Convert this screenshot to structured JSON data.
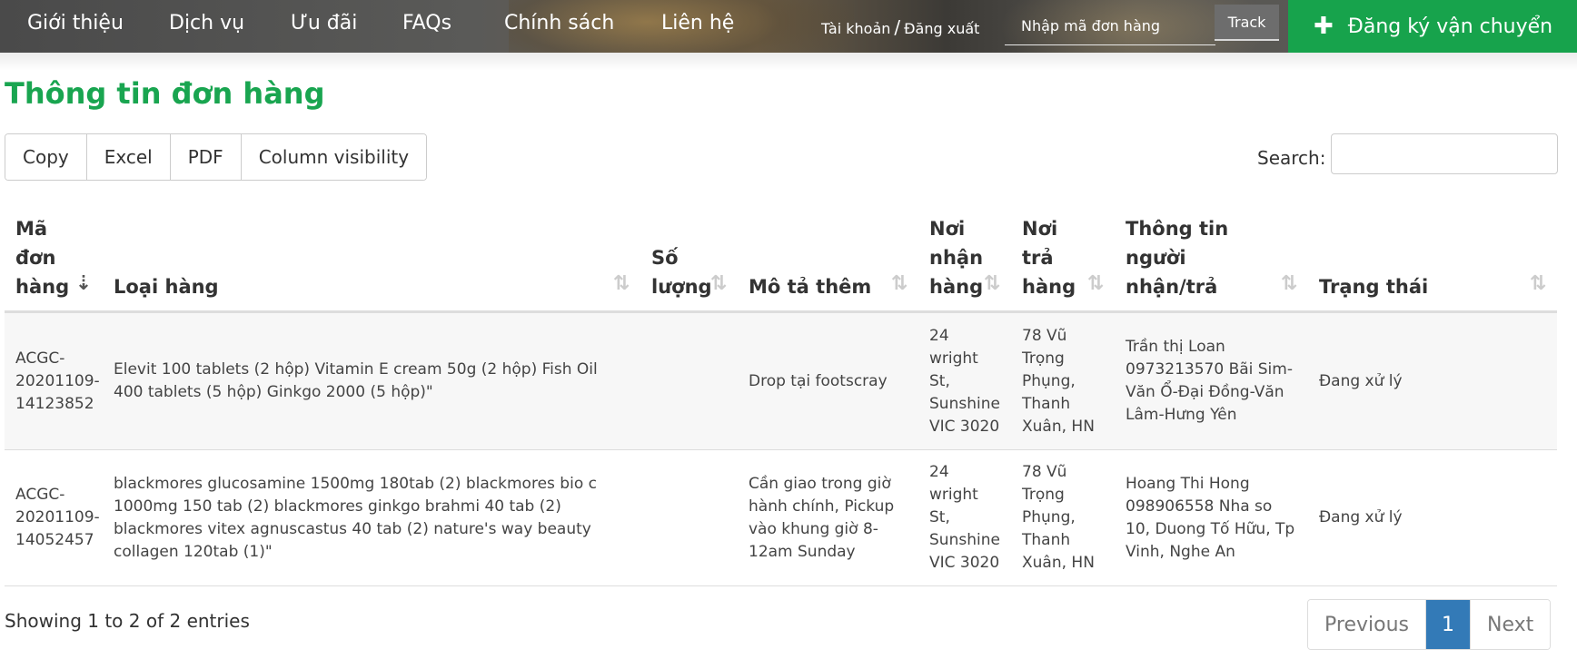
{
  "nav": {
    "items": [
      "Giới thiệu",
      "Dịch vụ",
      "Ưu đãi",
      "FAQs",
      "Chính sách",
      "Liên hệ"
    ],
    "account": "Tài khoản",
    "account_separator": "/",
    "logout": "Đăng xuất",
    "track_placeholder": "Nhập mã đơn hàng",
    "track_button": "Track",
    "register_button": "Đăng ký vận chuyển",
    "register_icon": "plus-icon"
  },
  "page": {
    "title": "Thông tin đơn hàng"
  },
  "toolbar": {
    "buttons": [
      "Copy",
      "Excel",
      "PDF",
      "Column visibility"
    ],
    "search_label": "Search:",
    "search_value": ""
  },
  "table": {
    "columns": [
      {
        "label": "Mã đơn hàng",
        "sort": "sorted-desc-icon"
      },
      {
        "label": "Loại hàng",
        "sort": "sort-icon"
      },
      {
        "label": "Số lượng",
        "sort": "sort-icon"
      },
      {
        "label": "Mô tả thêm",
        "sort": "sort-icon"
      },
      {
        "label": "Nơi nhận hàng",
        "sort": "sort-icon"
      },
      {
        "label": "Nơi trả hàng",
        "sort": "sort-icon"
      },
      {
        "label": "Thông tin người nhận/trả",
        "sort": "sort-icon"
      },
      {
        "label": "Trạng thái",
        "sort": "sort-icon"
      }
    ],
    "rows": [
      {
        "order_id": "ACGC-20201109-14123852",
        "goods": "Elevit 100 tablets (2 hộp) Vitamin E cream 50g (2 hộp) Fish Oil 400 tablets (5 hộp) Ginkgo 2000 (5 hộp)\"",
        "quantity": "",
        "note": "Drop tại footscray",
        "pickup": "24 wright St, Sunshine VIC 3020",
        "dropoff": "78 Vũ Trọng Phụng, Thanh Xuân, HN",
        "recipient": "Trần thị Loan 0973213570 Bãi Sim-Văn Ổ-Đại Đồng-Văn Lâm-Hưng Yên",
        "status": "Đang xử lý"
      },
      {
        "order_id": "ACGC-20201109-14052457",
        "goods": "blackmores glucosamine 1500mg 180tab (2) blackmores bio c 1000mg 150 tab (2) blackmores ginkgo brahmi 40 tab (2) blackmores vitex agnuscastus 40 tab (2) nature's way beauty collagen 120tab (1)\"",
        "quantity": "",
        "note": "Cần giao trong giờ hành chính, Pickup vào khung giờ 8-12am Sunday",
        "pickup": "24 wright St, Sunshine VIC 3020",
        "dropoff": "78 Vũ Trọng Phụng, Thanh Xuân, HN",
        "recipient": "Hoang Thi Hong 098906558 Nha so 10, Duong Tố Hữu, Tp Vinh, Nghe An",
        "status": "Đang xử lý"
      }
    ]
  },
  "footer": {
    "info": "Showing 1 to 2 of 2 entries",
    "previous": "Previous",
    "current_page": "1",
    "next": "Next"
  },
  "colors": {
    "brand_green": "#19a550",
    "register_green": "#17a34c",
    "pager_active": "#337ab7"
  }
}
